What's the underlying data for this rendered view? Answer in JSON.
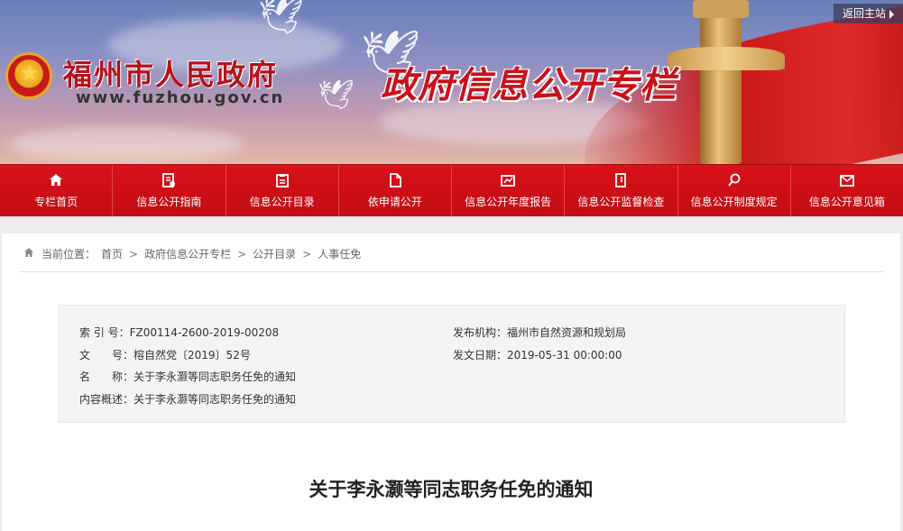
{
  "header": {
    "site_name": "福州市人民政府",
    "site_url": "www.fuzhou.gov.cn",
    "column_title": "政府信息公开专栏",
    "return_label": "返回主站"
  },
  "nav": {
    "items": [
      {
        "label": "专栏首页",
        "icon": "home-icon"
      },
      {
        "label": "信息公开指南",
        "icon": "guide-icon"
      },
      {
        "label": "信息公开目录",
        "icon": "catalog-icon"
      },
      {
        "label": "依申请公开",
        "icon": "document-icon"
      },
      {
        "label": "信息公开年度报告",
        "icon": "report-icon"
      },
      {
        "label": "信息公开监督检查",
        "icon": "inspection-icon"
      },
      {
        "label": "信息公开制度规定",
        "icon": "regulation-icon"
      },
      {
        "label": "信息公开意见箱",
        "icon": "mailbox-icon"
      }
    ]
  },
  "breadcrumb": {
    "prefix": "当前位置：",
    "items": [
      "首页",
      "政府信息公开专栏",
      "公开目录",
      "人事任免"
    ]
  },
  "meta": {
    "index_label": "索 引 号：",
    "index_value": "FZ00114-2600-2019-00208",
    "publisher_label": "发布机构：",
    "publisher_value": "福州市自然资源和规划局",
    "docno_label": "文　　号：",
    "docno_value": "榕自然党〔2019〕52号",
    "date_label": "发文日期：",
    "date_value": "2019-05-31 00:00:00",
    "name_label": "名　　称：",
    "name_value": "关于李永灏等同志职务任免的通知",
    "summary_label": "内容概述：",
    "summary_value": "关于李永灏等同志职务任免的通知"
  },
  "document": {
    "title": "关于李永灏等同志职务任免的通知"
  }
}
